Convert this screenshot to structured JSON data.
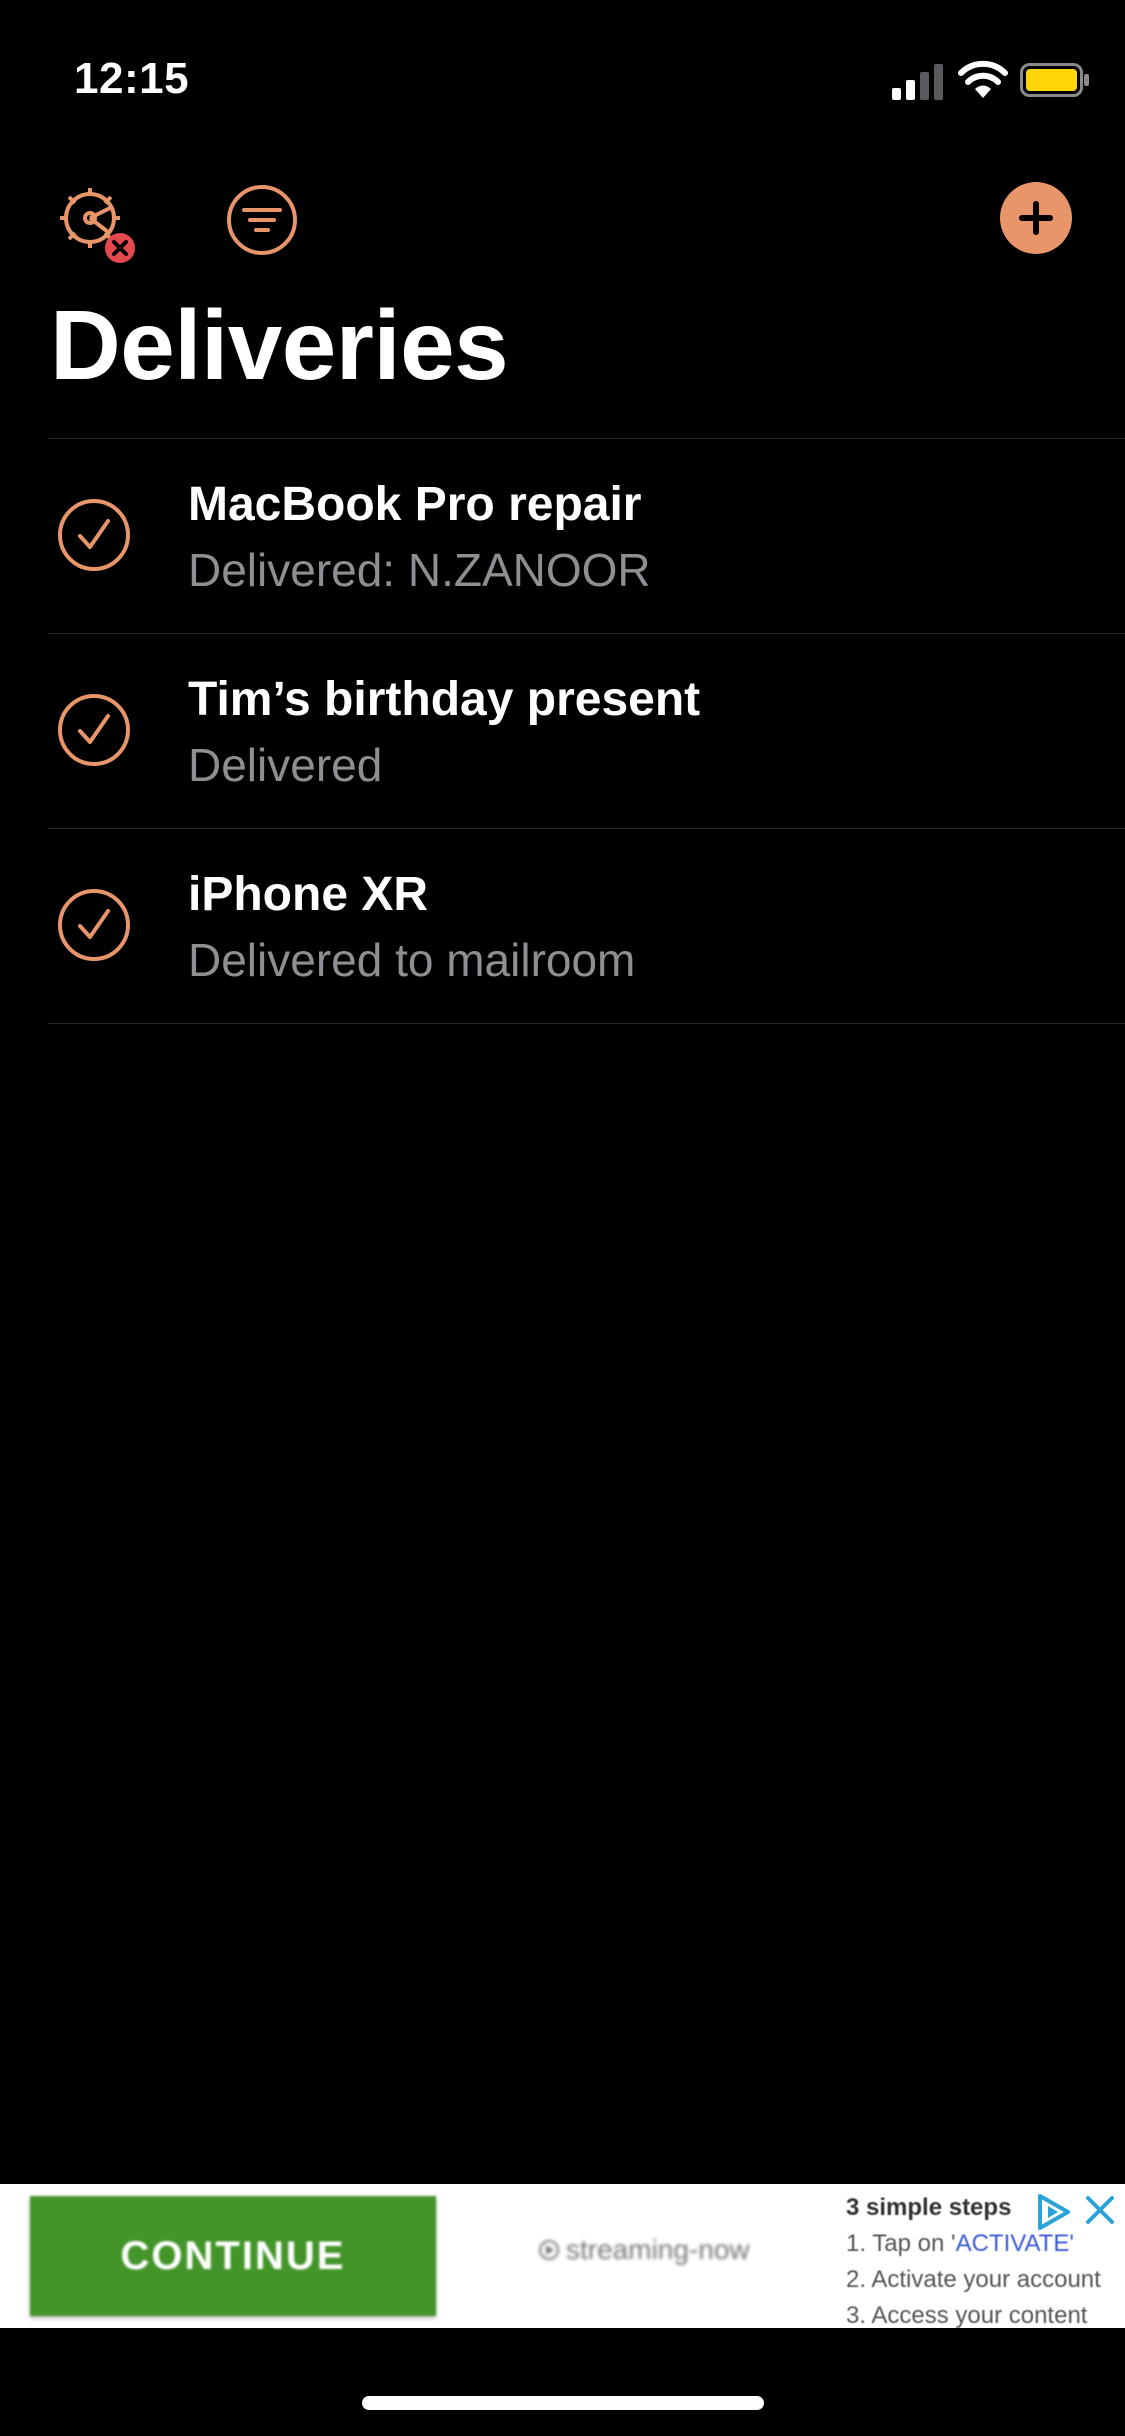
{
  "status_bar": {
    "time": "12:15"
  },
  "toolbar": {
    "settings_icon": "settings-error-icon",
    "filter_icon": "filter-icon",
    "add_icon": "plus-icon"
  },
  "page": {
    "title": "Deliveries"
  },
  "deliveries": [
    {
      "title": "MacBook Pro repair",
      "status": "Delivered: N.ZANOOR"
    },
    {
      "title": "Tim’s birthday present",
      "status": "Delivered"
    },
    {
      "title": "iPhone XR",
      "status": "Delivered to mailroom"
    }
  ],
  "ad": {
    "button_label": "CONTINUE",
    "brand": "streaming-now",
    "steps_title": "3 simple steps",
    "step_1_prefix": "1. Tap on '",
    "step_1_highlight": "ACTIVATE'",
    "step_2": "2. Activate your account",
    "step_3": "3. Access your content"
  },
  "colors": {
    "accent": "#E8956A",
    "error": "#E5484D",
    "secondary_text": "#8e8e93",
    "ad_button": "#43952a"
  }
}
